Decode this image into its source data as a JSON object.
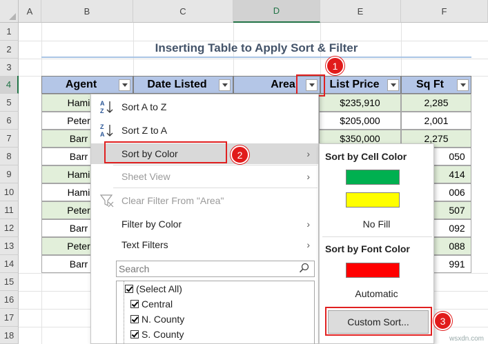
{
  "columns": [
    "A",
    "B",
    "C",
    "D",
    "E",
    "F"
  ],
  "rows": [
    "1",
    "2",
    "3",
    "4",
    "5",
    "6",
    "7",
    "8",
    "9",
    "10",
    "11",
    "12",
    "13",
    "14",
    "15",
    "16",
    "17",
    "18"
  ],
  "title": "Inserting Table to Apply Sort & Filter",
  "table": {
    "headers": [
      "Agent",
      "Date Listed",
      "Area",
      "List Price",
      "Sq Ft"
    ],
    "agent_col": [
      "Hami",
      "Peter",
      "Barr",
      "Barr",
      "Hami",
      "Hami",
      "Peter",
      "Barr",
      "Peter",
      "Barr"
    ],
    "price_col": [
      "$235,910",
      "$205,000",
      "$350,000"
    ],
    "sqft_col": [
      "2,285",
      "2,001",
      "2,275",
      "050",
      "414",
      "006",
      "507",
      "092",
      "088",
      "991"
    ]
  },
  "menu": {
    "sort_az": "Sort A to Z",
    "sort_za": "Sort Z to A",
    "sort_by_color": "Sort by Color",
    "sheet_view": "Sheet View",
    "clear_filter": "Clear Filter From \"Area\"",
    "filter_by_color": "Filter by Color",
    "text_filters": "Text Filters",
    "search_placeholder": "Search",
    "list_items": [
      "(Select All)",
      "Central",
      "N. County",
      "S. County"
    ]
  },
  "submenu": {
    "cell_color_heading": "Sort by Cell Color",
    "no_fill": "No Fill",
    "font_color_heading": "Sort by Font Color",
    "automatic": "Automatic",
    "custom_sort": "Custom Sort...",
    "cell_colors": [
      "#00b050",
      "#ffff00"
    ],
    "font_color": "#ff0000"
  },
  "badges": [
    "1",
    "2",
    "3"
  ],
  "watermark": "wsxdn.com"
}
